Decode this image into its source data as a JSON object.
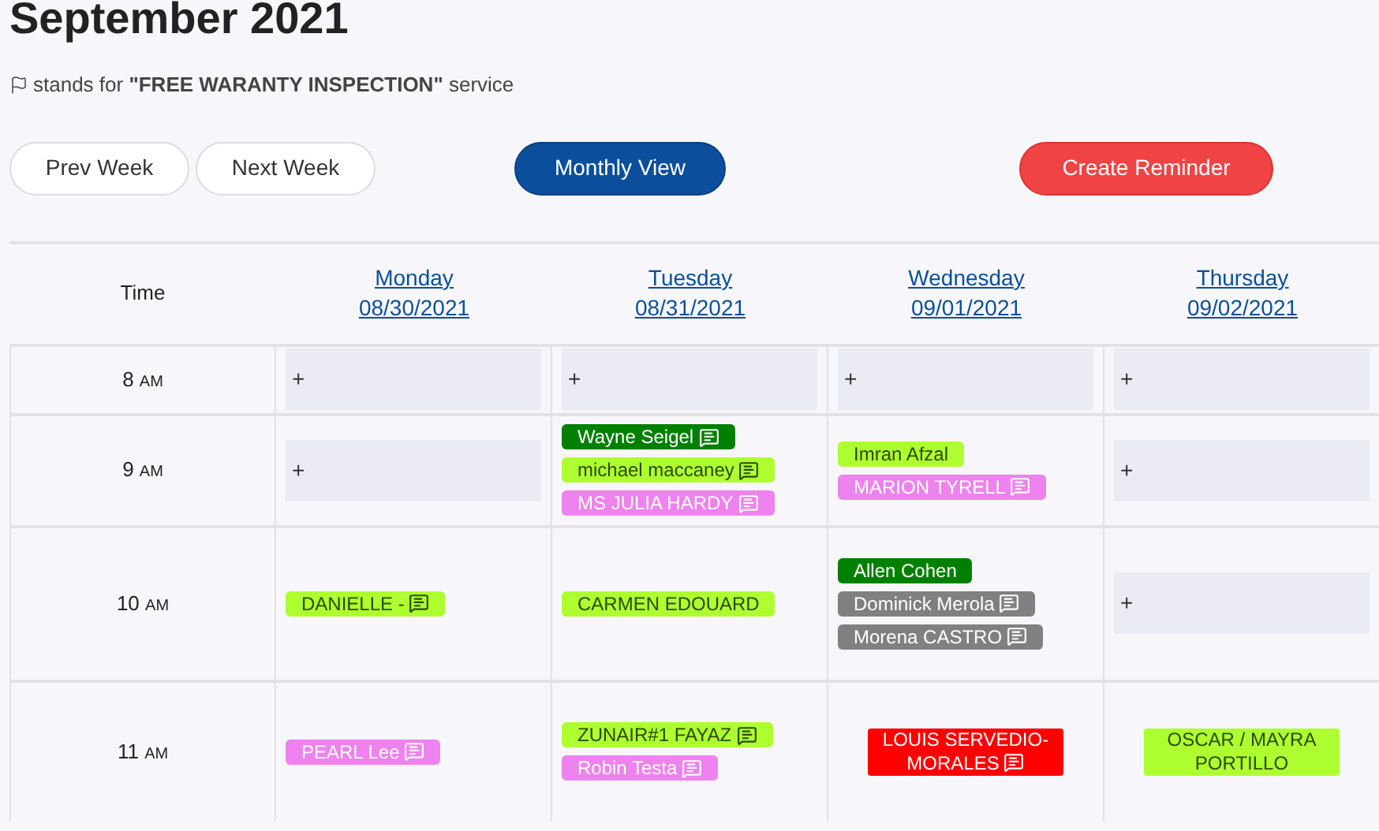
{
  "title": "September 2021",
  "legend": {
    "text": "stands for **\"FREE WARANTY INSPECTION\"** service"
  },
  "buttons": [
    {
      "label": "Prev Week",
      "kind": "outline"
    },
    {
      "label": "Next Week",
      "kind": "outline"
    },
    {
      "label": "Monthly View",
      "kind": "primary"
    },
    {
      "label": "Create Reminder",
      "kind": "danger"
    }
  ],
  "table": {
    "time_heading": "Time",
    "days": [
      {
        "name": "Monday",
        "date": "08/30/2021"
      },
      {
        "name": "Tuesday",
        "date": "08/31/2021"
      },
      {
        "name": "Wednesday",
        "date": "09/01/2021"
      },
      {
        "name": "Thursday",
        "date": "09/02/2021"
      }
    ],
    "rows": [
      {
        "hour": "8",
        "period": "AM",
        "cells": [
          {
            "kind": "empty",
            "add": "+"
          },
          {
            "kind": "empty",
            "add": "+"
          },
          {
            "kind": "empty",
            "add": "+"
          },
          {
            "kind": "empty",
            "add": "+"
          }
        ]
      },
      {
        "hour": "9",
        "period": "AM",
        "cells": [
          {
            "kind": "empty",
            "add": "+"
          },
          {
            "kind": "events",
            "events": [
              {
                "name": "Wayne Seigel",
                "color": "#008000",
                "note": true
              },
              {
                "name": "michael maccaney",
                "color": "#adff2f",
                "note": true
              },
              {
                "name": "MS JULIA HARDY",
                "color": "#ee82ee",
                "note": true
              }
            ]
          },
          {
            "kind": "events",
            "events": [
              {
                "name": "Imran Afzal",
                "color": "#adff2f",
                "note": false
              },
              {
                "name": "MARION TYRELL",
                "color": "#ee82ee",
                "note": true
              }
            ]
          },
          {
            "kind": "empty",
            "add": "+"
          }
        ]
      },
      {
        "hour": "10",
        "period": "AM",
        "cells": [
          {
            "kind": "events",
            "events": [
              {
                "name": "DANIELLE -",
                "color": "#adff2f",
                "note": true
              }
            ]
          },
          {
            "kind": "events",
            "events": [
              {
                "name": "CARMEN EDOUARD",
                "color": "#adff2f",
                "note": false
              }
            ]
          },
          {
            "kind": "events",
            "events": [
              {
                "name": "Allen Cohen",
                "color": "#008000",
                "note": false
              },
              {
                "name": "Dominick Merola",
                "color": "#808080",
                "note": true
              },
              {
                "name": "Morena CASTRO",
                "color": "#808080",
                "note": true
              }
            ]
          },
          {
            "kind": "empty",
            "add": "+"
          }
        ]
      },
      {
        "hour": "11",
        "period": "AM",
        "cells": [
          {
            "kind": "events",
            "events": [
              {
                "name": "PEARL Lee",
                "color": "#ee82ee",
                "note": true
              }
            ]
          },
          {
            "kind": "events",
            "events": [
              {
                "name": "ZUNAIR#1 FAYAZ",
                "color": "#adff2f",
                "note": true
              },
              {
                "name": "Robin Testa",
                "color": "#ee82ee",
                "note": true
              }
            ]
          },
          {
            "kind": "events",
            "wrapped": true,
            "events": [
              {
                "name": "LOUIS SERVEDIO-MORALES",
                "color": "#ff0000",
                "note": true
              }
            ]
          },
          {
            "kind": "events",
            "wrapped": true,
            "events": [
              {
                "name": "OSCAR / MAYRA PORTILLO",
                "color": "#adff2f",
                "note": false
              }
            ]
          }
        ]
      }
    ]
  }
}
